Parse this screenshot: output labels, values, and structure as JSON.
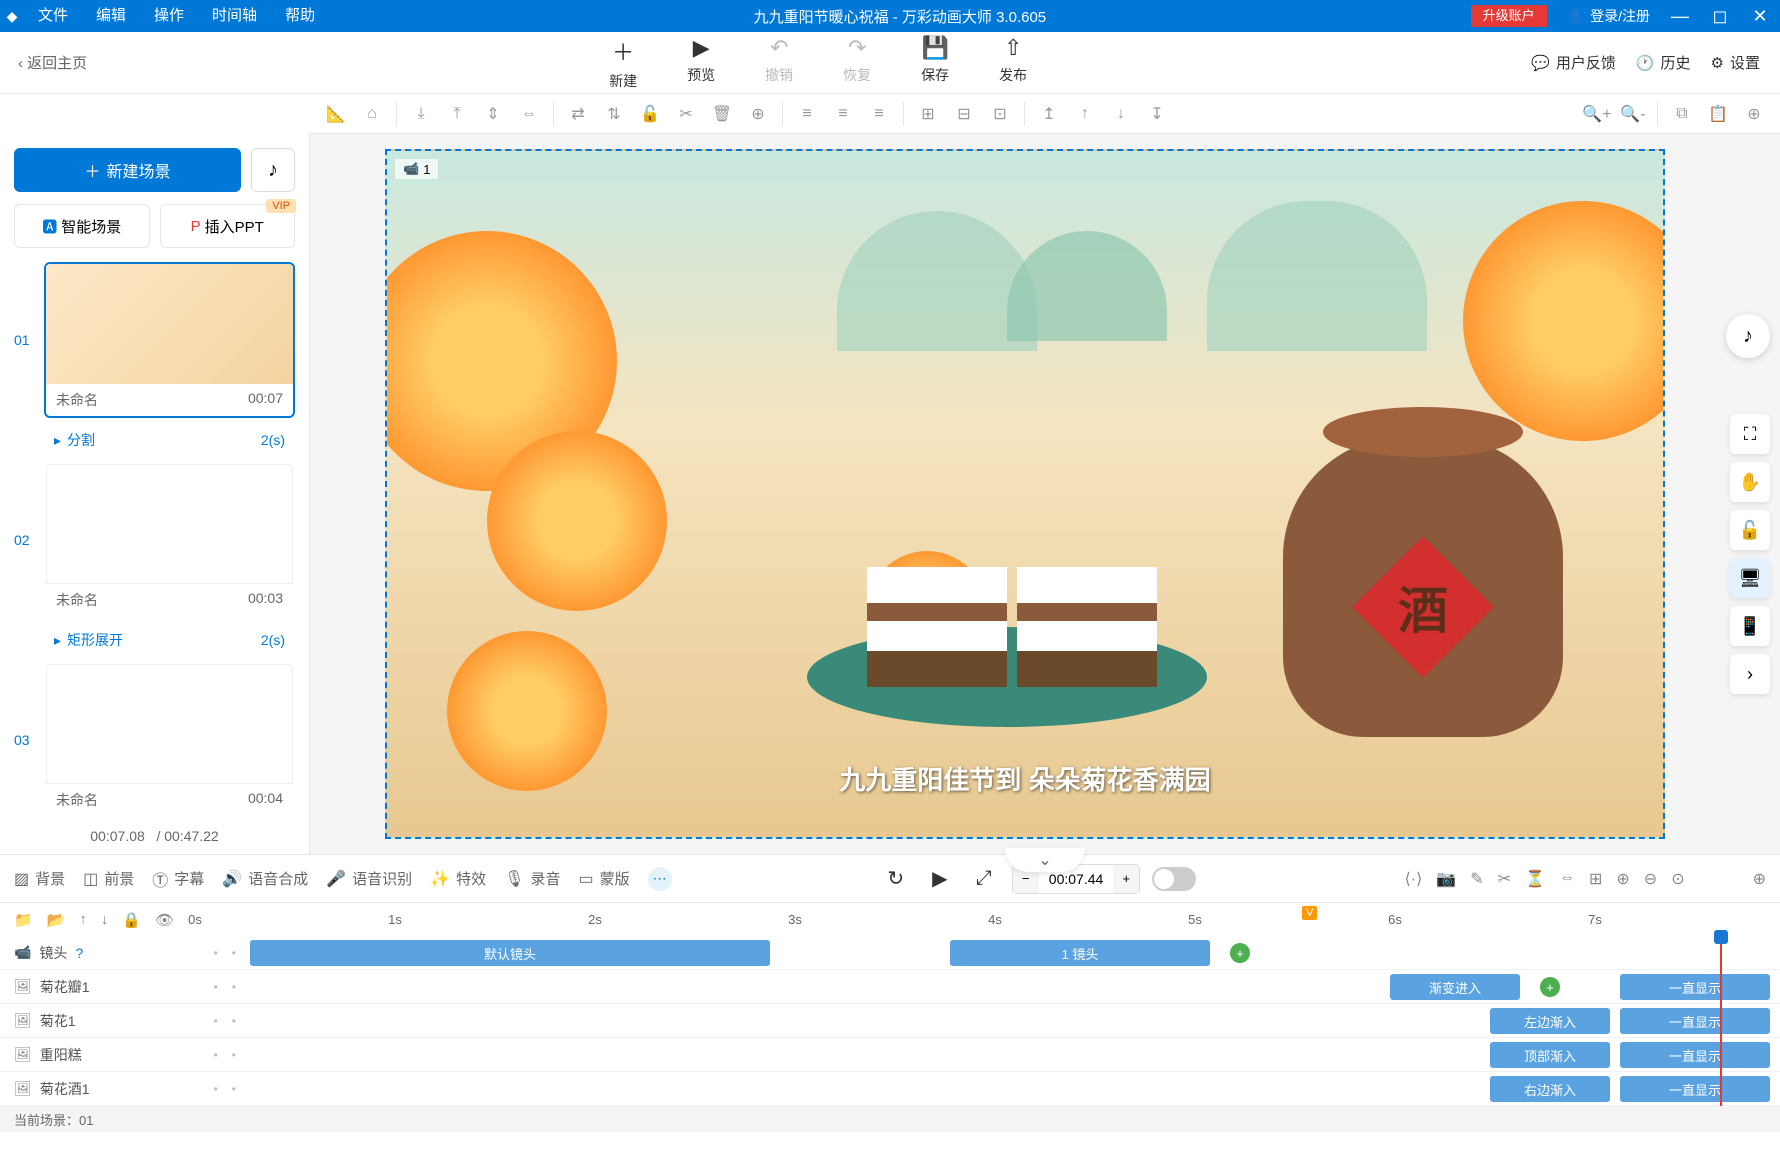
{
  "titlebar": {
    "menus": [
      "文件",
      "编辑",
      "操作",
      "时间轴",
      "帮助"
    ],
    "title": "九九重阳节暖心祝福 - 万彩动画大师 3.0.605",
    "upgrade": "升级账户",
    "login": "登录/注册"
  },
  "toolbar": {
    "back": "返回主页",
    "buttons": [
      {
        "label": "新建",
        "icon": "＋"
      },
      {
        "label": "预览",
        "icon": "▶"
      },
      {
        "label": "撤销",
        "icon": "↶",
        "disabled": true
      },
      {
        "label": "恢复",
        "icon": "↷",
        "disabled": true
      },
      {
        "label": "保存",
        "icon": "💾"
      },
      {
        "label": "发布",
        "icon": "⇧"
      }
    ],
    "right": [
      {
        "label": "用户反馈",
        "icon": "💬"
      },
      {
        "label": "历史",
        "icon": "🕐"
      },
      {
        "label": "设置",
        "icon": "⚙"
      }
    ]
  },
  "sidebar": {
    "new_scene": "新建场景",
    "ai_scene": "智能场景",
    "insert_ppt": "插入PPT",
    "vip": "VIP",
    "scenes": [
      {
        "num": "01",
        "name": "未命名",
        "time": "00:07",
        "active": true
      },
      {
        "num": "02",
        "name": "未命名",
        "time": "00:03"
      },
      {
        "num": "03",
        "name": "未命名",
        "time": "00:04"
      }
    ],
    "transitions": [
      {
        "name": "分割",
        "time": "2(s)"
      },
      {
        "name": "矩形展开",
        "time": "2(s)"
      }
    ],
    "current_time": "00:07.08",
    "total_time": "/ 00:47.22"
  },
  "canvas": {
    "cam_num": "1",
    "jar_char": "酒",
    "subtitle": "九九重阳佳节到 朵朵菊花香满园"
  },
  "bottom_tabs": {
    "tabs": [
      "背景",
      "前景",
      "字幕",
      "语音合成",
      "语音识别",
      "特效",
      "录音",
      "蒙版"
    ],
    "time": "00:07.44"
  },
  "timeline": {
    "ruler": [
      "0s",
      "1s",
      "2s",
      "3s",
      "4s",
      "5s",
      "6s",
      "7s"
    ],
    "rows": [
      {
        "icon": "📹",
        "label": "镜头",
        "help": true
      },
      {
        "icon": "🖼",
        "label": "菊花瓣1"
      },
      {
        "icon": "🖼",
        "label": "菊花1"
      },
      {
        "icon": "🖼",
        "label": "重阳糕"
      },
      {
        "icon": "🖼",
        "label": "菊花酒1"
      }
    ],
    "clips": {
      "default_cam": "默认镜头",
      "cam1": "1 镜头",
      "fade_in": "渐变进入",
      "left_in": "左边渐入",
      "top_in": "顶部渐入",
      "right_in": "右边渐入",
      "keep_show": "一直显示"
    },
    "v_badge": "V"
  },
  "status": {
    "current_scene": "当前场景：01"
  }
}
